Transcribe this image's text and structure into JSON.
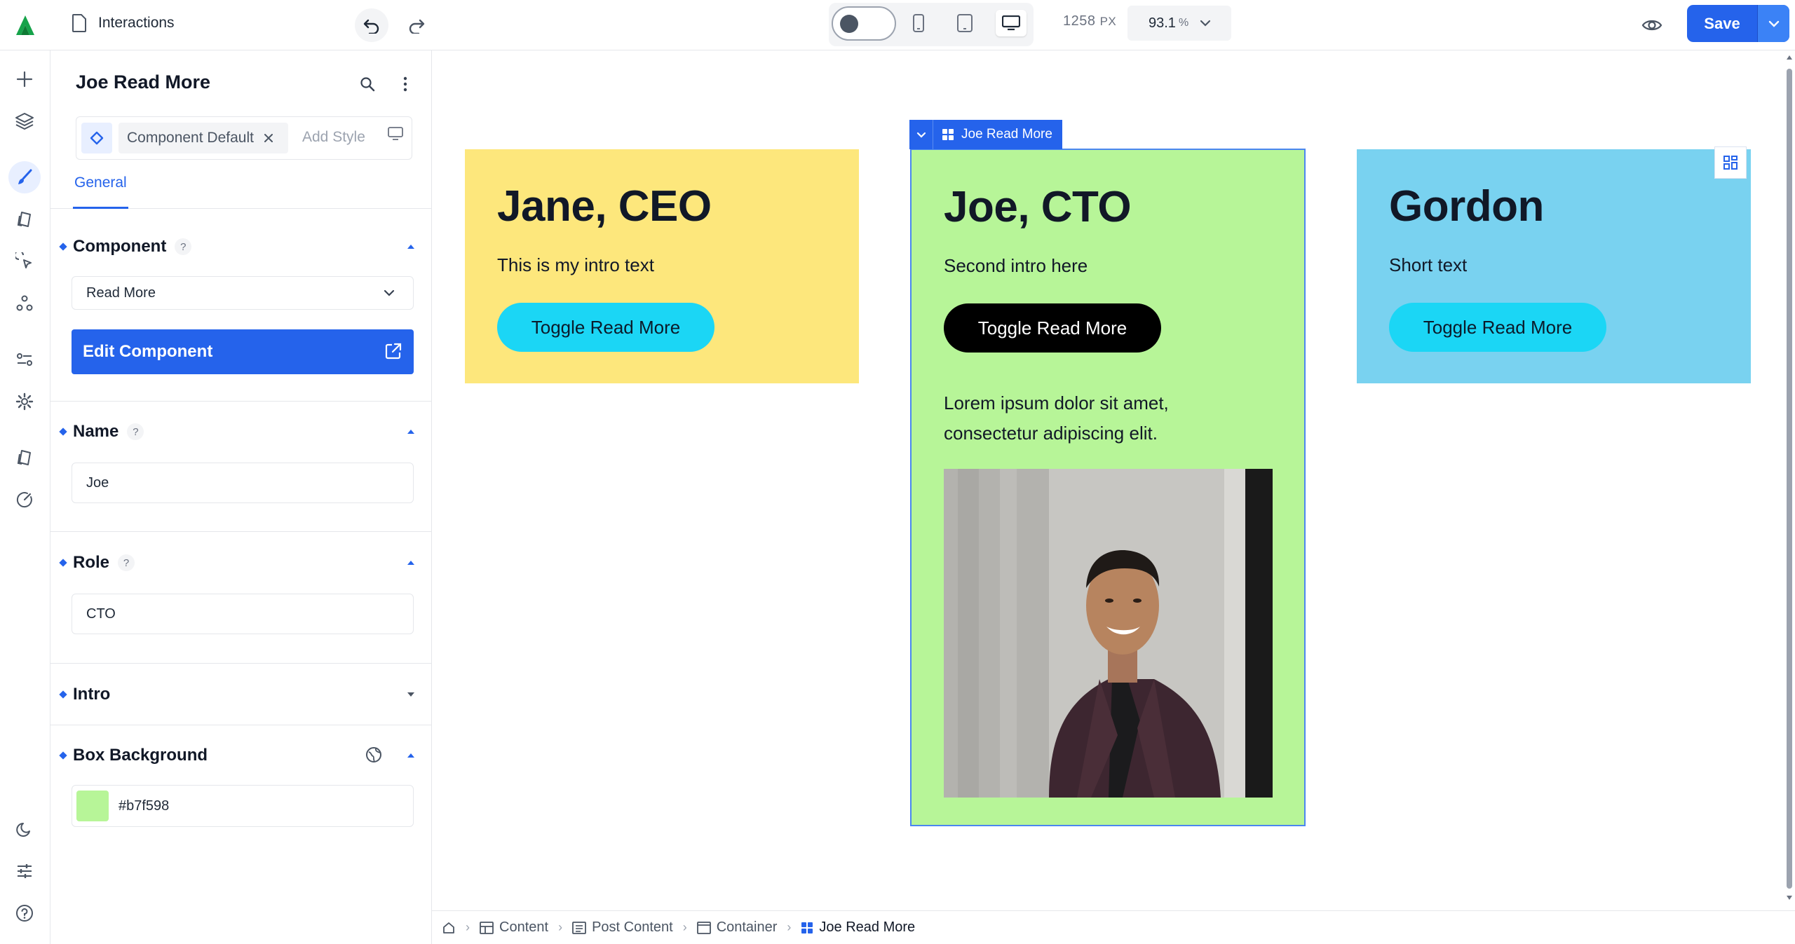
{
  "topbar": {
    "document_title": "Interactions",
    "canvas_width": "1258",
    "canvas_width_unit": "PX",
    "zoom_value": "93.1",
    "zoom_unit": "%",
    "save_label": "Save"
  },
  "panel": {
    "title": "Joe Read More",
    "style_chip": "Component Default",
    "add_style_placeholder": "Add Style",
    "tab_general": "General",
    "component_section": "Component",
    "component_value": "Read More",
    "edit_component_label": "Edit Component",
    "name_section": "Name",
    "name_value": "Joe",
    "role_section": "Role",
    "role_value": "CTO",
    "intro_section": "Intro",
    "box_background_section": "Box Background",
    "box_background_value": "#b7f598",
    "help_mark": "?"
  },
  "canvas": {
    "selection_label": "Joe Read More",
    "cards": [
      {
        "title": "Jane, CEO",
        "intro": "This is my intro text",
        "button": "Toggle Read More",
        "bg": "#fde77c"
      },
      {
        "title": "Joe, CTO",
        "intro": "Second intro here",
        "button": "Toggle Read More",
        "bg": "#b7f598",
        "lorem": "Lorem ipsum dolor sit amet, consectetur adipiscing elit."
      },
      {
        "title": "Gordon",
        "intro": "Short text",
        "button": "Toggle Read More",
        "bg": "#79d2f0"
      }
    ]
  },
  "breadcrumbs": [
    "Content",
    "Post Content",
    "Container",
    "Joe Read More"
  ],
  "colors": {
    "accent": "#2563eb",
    "cyan_button": "#1bd6f5"
  }
}
